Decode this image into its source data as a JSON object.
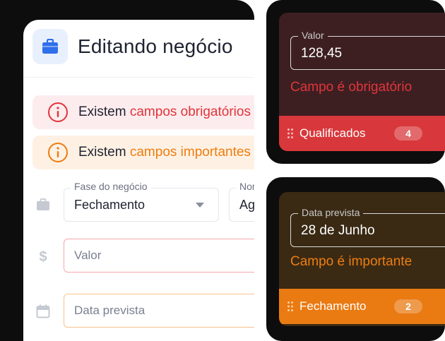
{
  "form": {
    "title": "Editando negócio",
    "alerts": {
      "required_prefix": "Existem ",
      "required_highlight": "campos obrigatórios",
      "important_prefix": "Existem ",
      "important_highlight": "campos importantes"
    },
    "fields": {
      "fase_label": "Fase do negócio",
      "fase_value": "Fechamento",
      "second_label": "Nome",
      "second_value": "Ag",
      "valor_placeholder": "Valor",
      "data_placeholder": "Data prevista"
    }
  },
  "card_required": {
    "field_label": "Valor",
    "field_value": "128,45",
    "message": "Campo é obrigatório",
    "stage_label": "Qualificados",
    "count": "4"
  },
  "card_important": {
    "field_label": "Data prevista",
    "field_value": "28 de Junho",
    "message": "Campo é importante",
    "stage_label": "Fechamento",
    "count": "2"
  },
  "colors": {
    "required": "#e0353b",
    "important": "#ee7d10",
    "accent": "#2f6fea"
  },
  "icons": [
    "briefcase-icon",
    "info-icon",
    "dollar-icon",
    "calendar-icon",
    "caret-down-icon",
    "drag-handle-icon"
  ]
}
